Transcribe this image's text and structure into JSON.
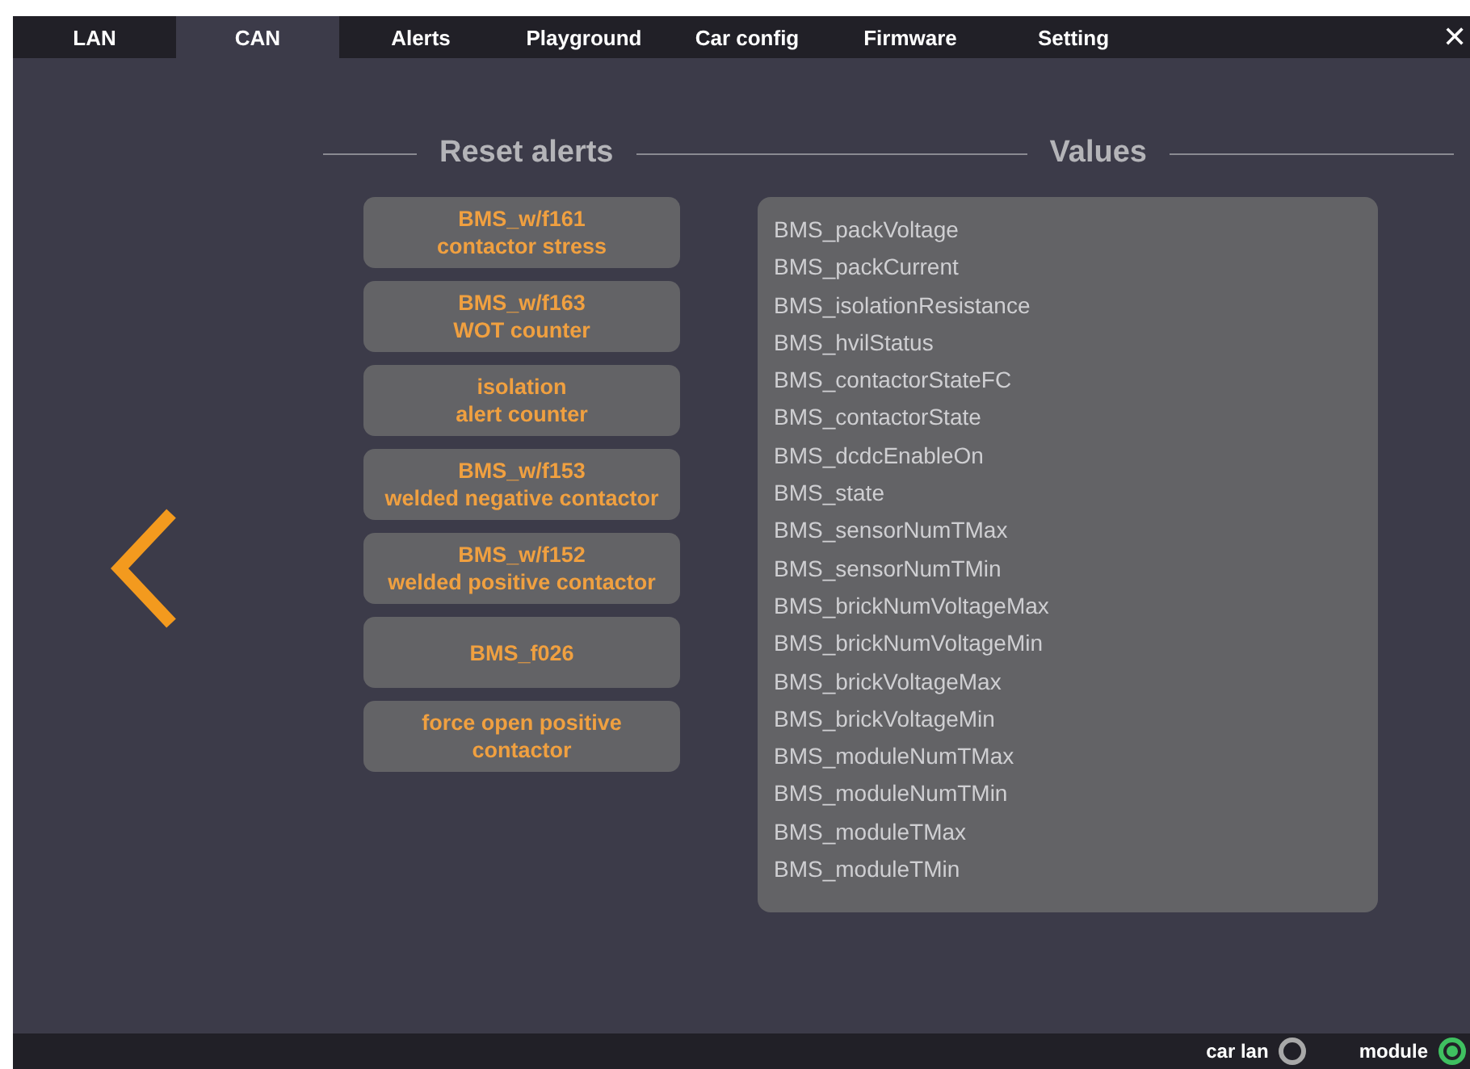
{
  "tabs": [
    {
      "label": "LAN",
      "selected": false
    },
    {
      "label": "CAN",
      "selected": true
    },
    {
      "label": "Alerts",
      "selected": false
    },
    {
      "label": "Playground",
      "selected": false
    },
    {
      "label": "Car config",
      "selected": false
    },
    {
      "label": "Firmware",
      "selected": false
    },
    {
      "label": "Setting",
      "selected": false
    }
  ],
  "close": "✕",
  "reset_alerts": {
    "title": "Reset alerts",
    "buttons": [
      [
        "BMS_w/f161",
        "contactor stress"
      ],
      [
        "BMS_w/f163",
        "WOT counter"
      ],
      [
        "isolation",
        "alert counter"
      ],
      [
        "BMS_w/f153",
        "welded negative contactor"
      ],
      [
        "BMS_w/f152",
        "welded positive contactor"
      ],
      [
        "BMS_f026"
      ],
      [
        "force open positive",
        "contactor"
      ]
    ]
  },
  "values": {
    "title": "Values",
    "items": [
      "BMS_packVoltage",
      "BMS_packCurrent",
      "BMS_isolationResistance",
      "BMS_hvilStatus",
      "BMS_contactorStateFC",
      "BMS_contactorState",
      "BMS_dcdcEnableOn",
      "BMS_state",
      "BMS_sensorNumTMax",
      "BMS_sensorNumTMin",
      "BMS_brickNumVoltageMax",
      "BMS_brickNumVoltageMin",
      "BMS_brickVoltageMax",
      "BMS_brickVoltageMin",
      "BMS_moduleNumTMax",
      "BMS_moduleNumTMin",
      "BMS_moduleTMax",
      "BMS_moduleTMin"
    ]
  },
  "status_bar": [
    {
      "label": "car lan",
      "connected": false
    },
    {
      "label": "module",
      "connected": true
    }
  ]
}
